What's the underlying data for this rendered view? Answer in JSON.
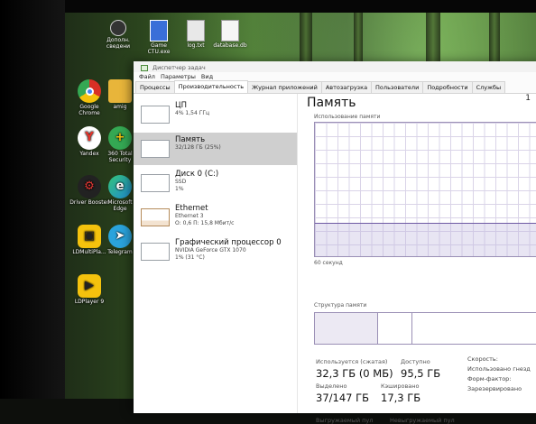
{
  "desktop": {
    "top_icons": [
      {
        "label": "Дополн. сведени",
        "icon": "clock-icon"
      },
      {
        "label": "Game CTU.exe",
        "icon": "exe-icon"
      },
      {
        "label": "log.txt",
        "icon": "text-file-icon"
      },
      {
        "label": "database.db",
        "icon": "database-icon"
      }
    ],
    "left_icons": [
      {
        "label": "Google Chrome",
        "icon": "chrome-icon",
        "color": "#d93025"
      },
      {
        "label": "Yandex",
        "icon": "yandex-icon",
        "color": "#e6332a"
      },
      {
        "label": "Driver Booster",
        "icon": "driver-booster-icon",
        "color": "#c62828"
      },
      {
        "label": "LDMultiPla...",
        "icon": "ldmultiplayer-icon",
        "color": "#f4c20d"
      },
      {
        "label": "LDPlayer 9",
        "icon": "ldplayer-icon",
        "color": "#f4c20d"
      }
    ],
    "second_icons": [
      {
        "label": "amig",
        "icon": "folder-icon",
        "color": "#e8b53a"
      },
      {
        "label": "360 Total Security",
        "icon": "security-360-icon",
        "color": "#34a853"
      },
      {
        "label": "Microsoft Edge",
        "icon": "edge-icon",
        "color": "#1f8bd1"
      },
      {
        "label": "Telegram",
        "icon": "telegram-icon",
        "color": "#2aa3dc"
      }
    ]
  },
  "taskmanager": {
    "title": "Диспетчер задач",
    "menu": [
      "Файл",
      "Параметры",
      "Вид"
    ],
    "tabs": [
      "Процессы",
      "Производительность",
      "Журнал приложений",
      "Автозагрузка",
      "Пользователи",
      "Подробности",
      "Службы"
    ],
    "active_tab": 1,
    "items": [
      {
        "name": "ЦП",
        "lines": [
          "4% 1,54 ГГц"
        ]
      },
      {
        "name": "Память",
        "lines": [
          "32/128 ГБ (25%)"
        ],
        "selected": true
      },
      {
        "name": "Диск 0 (C:)",
        "lines": [
          "SSD",
          "1%"
        ]
      },
      {
        "name": "Ethernet",
        "lines": [
          "Ethernet 3",
          "О: 0,6 П: 15,8 Мбит/с"
        ]
      },
      {
        "name": "Графический процессор 0",
        "lines": [
          "NVIDIA GeForce GTX 1070",
          "1% (31 °C)"
        ]
      }
    ],
    "memory": {
      "title": "Память",
      "right_glyph": "1",
      "graph_label": "Использование памяти",
      "time_label": "60 секунд",
      "usage_fraction": 0.25,
      "struct_label": "Структура памяти",
      "stats": [
        {
          "label": "Используется (сжатая)",
          "value": "32,3 ГБ (0 МБ)"
        },
        {
          "label": "Доступно",
          "value": "95,5 ГБ"
        },
        {
          "label": "Выделено",
          "value": "37/147 ГБ"
        },
        {
          "label": "Кэшировано",
          "value": "17,3 ГБ"
        },
        {
          "label": "Выгружаемый пул",
          "value": ""
        },
        {
          "label": "Невыгружаемый пул",
          "value": ""
        }
      ],
      "side": [
        "Скорость:",
        "Использовано гнезд",
        "Форм-фактор:",
        "Зарезервировано"
      ]
    }
  }
}
